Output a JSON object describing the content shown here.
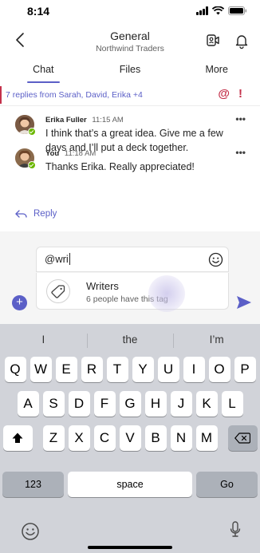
{
  "status_bar": {
    "time": "8:14"
  },
  "header": {
    "title": "General",
    "subtitle": "Northwind Traders",
    "icons": [
      "back-chevron-icon",
      "video-call-icon",
      "notification-bell-icon"
    ]
  },
  "tabs": [
    {
      "label": "Chat",
      "active": true
    },
    {
      "label": "Files",
      "active": false
    },
    {
      "label": "More",
      "active": false
    }
  ],
  "thread": {
    "replies_summary": "7 replies from Sarah, David, Erika +4",
    "mention_mark": "@",
    "important_mark": "!",
    "messages": [
      {
        "author": "Erika Fuller",
        "time": "11:15 AM",
        "text": "I think that’s a great idea. Give me a few days and I’ll put a deck together.",
        "more": "•••"
      },
      {
        "author": "You",
        "time": "11:18 AM",
        "text": "Thanks Erika. Really appreciated!",
        "more": "•••"
      }
    ],
    "reply_label": "Reply"
  },
  "compose": {
    "value": "@wri",
    "suggestion": {
      "title": "Writers",
      "subtitle": "6 people have this tag"
    },
    "plus_label": "+"
  },
  "keyboard": {
    "predictions": [
      "I",
      "the",
      "I’m"
    ],
    "row1": [
      "Q",
      "W",
      "E",
      "R",
      "T",
      "Y",
      "U",
      "I",
      "O",
      "P"
    ],
    "row2": [
      "A",
      "S",
      "D",
      "F",
      "G",
      "H",
      "J",
      "K",
      "L"
    ],
    "row3": [
      "Z",
      "X",
      "C",
      "V",
      "B",
      "N",
      "M"
    ],
    "numbers_key": "123",
    "space_key": "space",
    "go_key": "Go"
  },
  "colors": {
    "accent": "#5b5fc7",
    "alert": "#c4314b",
    "presence": "#6bb700"
  }
}
